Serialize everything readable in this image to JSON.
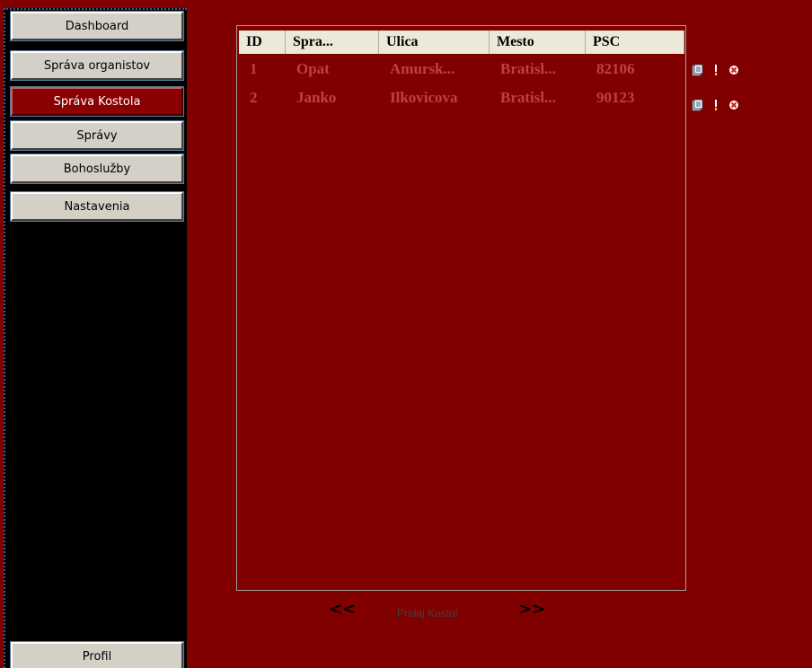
{
  "sidebar": {
    "items": [
      {
        "label": "Dashboard"
      },
      {
        "label": "Správa organistov"
      },
      {
        "label": "Správa Kostola"
      },
      {
        "label": "Správy"
      },
      {
        "label": "Bohoslužby"
      },
      {
        "label": "Nastavenia"
      }
    ],
    "active_index": 2,
    "profile_label": "Profil"
  },
  "table": {
    "columns": [
      "ID",
      "Spra...",
      "Ulica",
      "Mesto",
      "PSC"
    ],
    "rows": [
      [
        "1",
        "Opat",
        "Amursk...",
        "Bratisl...",
        "82106"
      ],
      [
        "2",
        "Janko",
        "Ilkovicova",
        "Bratisl...",
        "90123"
      ]
    ]
  },
  "row_actions": {
    "icons": [
      "edit-icon",
      "info-icon",
      "delete-icon"
    ]
  },
  "pager": {
    "prev_label": "<<",
    "add_label": "Pridaj Kostol",
    "next_label": ">>"
  },
  "colors": {
    "background": "#800000",
    "sidebar": "#000000",
    "active_button": "#8b0000",
    "header_bg": "#ece9d8",
    "cell_text": "#c04040"
  }
}
